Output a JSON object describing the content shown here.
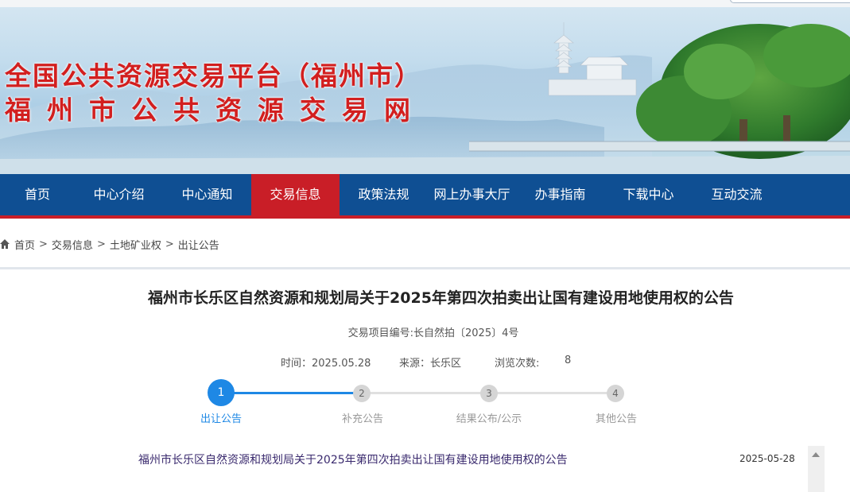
{
  "banner": {
    "title_line1": "全国公共资源交易平台（福州市）",
    "title_line2": "福州市公共资源交易网"
  },
  "nav": {
    "items": [
      "首页",
      "中心介绍",
      "中心通知",
      "交易信息",
      "政策法规",
      "网上办事大厅",
      "办事指南",
      "下载中心",
      "互动交流"
    ],
    "active_index": 3
  },
  "breadcrumb": {
    "home_icon": "home-icon",
    "separator": ">",
    "items": [
      "首页",
      "交易信息",
      "土地矿业权",
      "出让公告"
    ]
  },
  "article": {
    "title": "福州市长乐区自然资源和规划局关于2025年第四次拍卖出让国有建设用地使用权的公告",
    "project_code": "交易项目编号:长自然拍〔2025〕4号",
    "time_label": "时间：",
    "time_value": "2025.05.28",
    "source_label": "来源：",
    "source_value": "长乐区",
    "views_label": "浏览次数:",
    "views_value": "8"
  },
  "steps": [
    {
      "number": "1",
      "label": "出让公告",
      "active": true
    },
    {
      "number": "2",
      "label": "补充公告",
      "active": false
    },
    {
      "number": "3",
      "label": "结果公布/公示",
      "active": false
    },
    {
      "number": "4",
      "label": "其他公告",
      "active": false
    }
  ],
  "list": {
    "items": [
      {
        "title": "福州市长乐区自然资源和规划局关于2025年第四次拍卖出让国有建设用地使用权的公告",
        "date": "2025-05-28"
      }
    ]
  },
  "colors": {
    "nav_bg": "#0f4f93",
    "nav_active": "#c91e27",
    "title_red": "#d21f1f",
    "step_active": "#1e88e5",
    "step_inactive": "#d5d5d5",
    "link_purple": "#3a2a6e"
  }
}
